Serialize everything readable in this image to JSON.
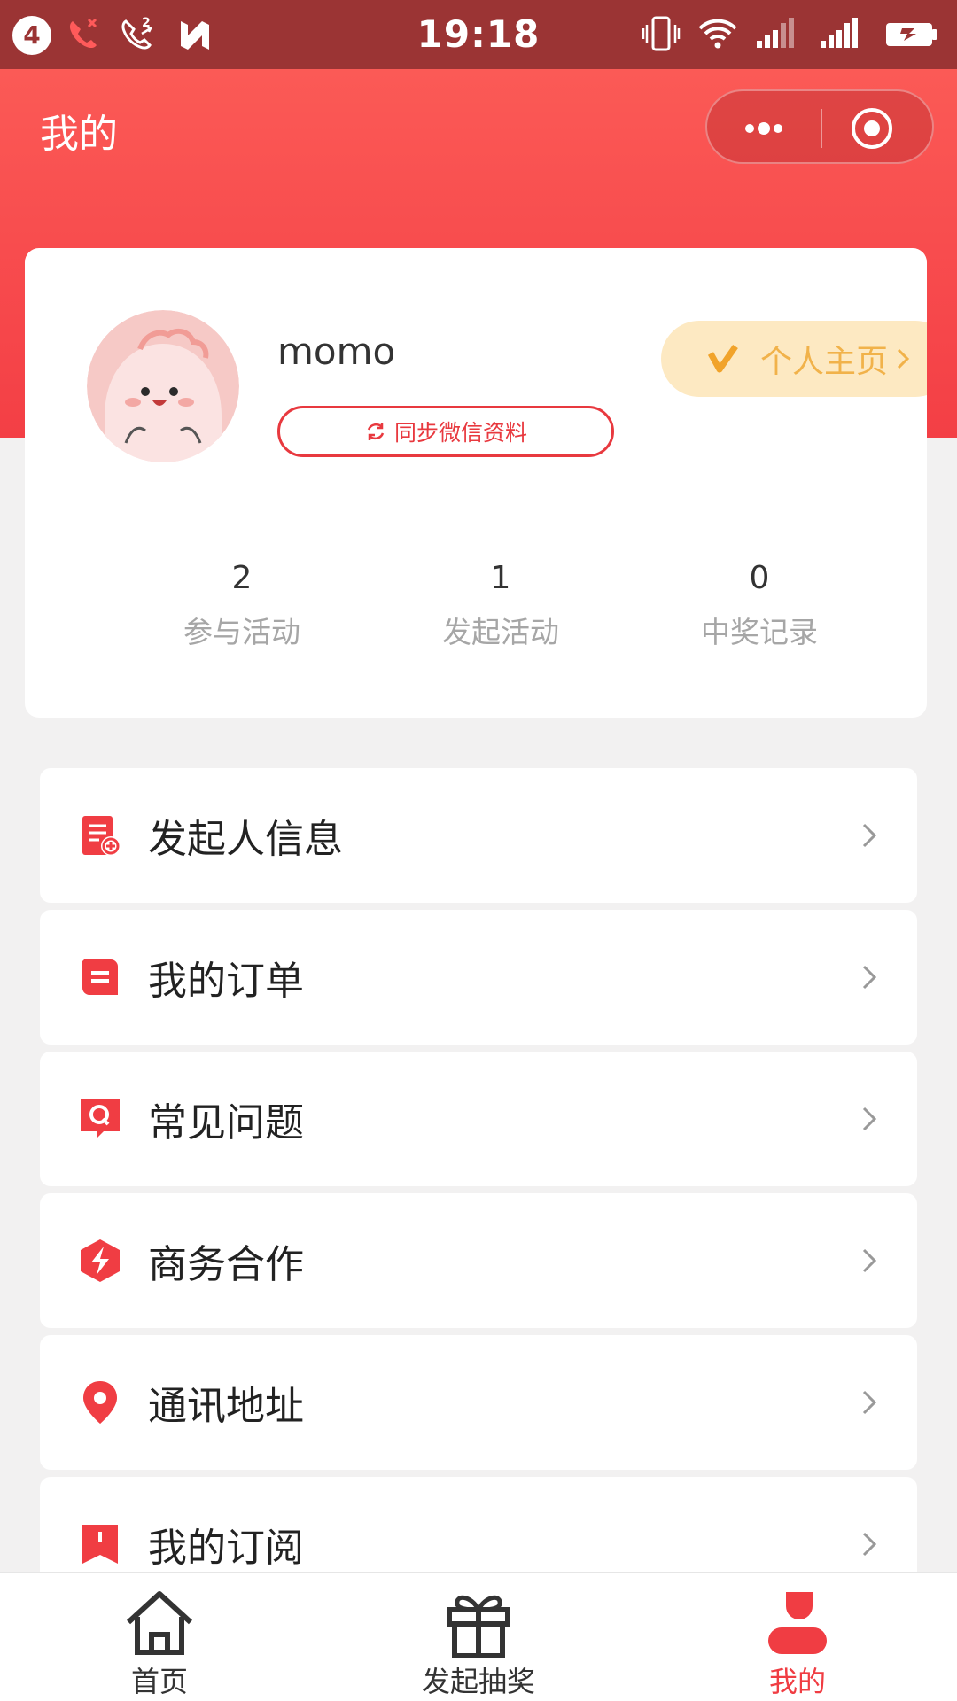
{
  "status_bar": {
    "notification_count": "4",
    "time": "19:18"
  },
  "header": {
    "title": "我的",
    "capsule": {
      "more_icon": "more-dots-icon",
      "close_icon": "target-close-icon"
    }
  },
  "profile": {
    "username": "momo",
    "sync_label": "同步微信资料",
    "homepage_label": "个人主页",
    "stats": [
      {
        "value": "2",
        "label": "参与活动"
      },
      {
        "value": "1",
        "label": "发起活动"
      },
      {
        "value": "0",
        "label": "中奖记录"
      }
    ]
  },
  "menu": {
    "items": [
      {
        "label": "发起人信息",
        "icon": "document-plus-icon"
      },
      {
        "label": "我的订单",
        "icon": "order-chat-icon"
      },
      {
        "label": "常见问题",
        "icon": "question-bubble-icon"
      },
      {
        "label": "商务合作",
        "icon": "lightning-hexagon-icon"
      },
      {
        "label": "通讯地址",
        "icon": "location-pin-icon"
      },
      {
        "label": "我的订阅",
        "icon": "bookmark-icon"
      }
    ]
  },
  "tabbar": {
    "tabs": [
      {
        "label": "首页",
        "icon": "home-icon",
        "active": false
      },
      {
        "label": "发起抽奖",
        "icon": "gift-icon",
        "active": false
      },
      {
        "label": "我的",
        "icon": "user-icon",
        "active": true
      }
    ]
  },
  "colors": {
    "accent": "#f03d43",
    "header_gradient_top": "#fb5a56",
    "status_bar": "#9b3434",
    "homepage_bg": "#fde9c2",
    "homepage_text": "#f1b24a"
  }
}
